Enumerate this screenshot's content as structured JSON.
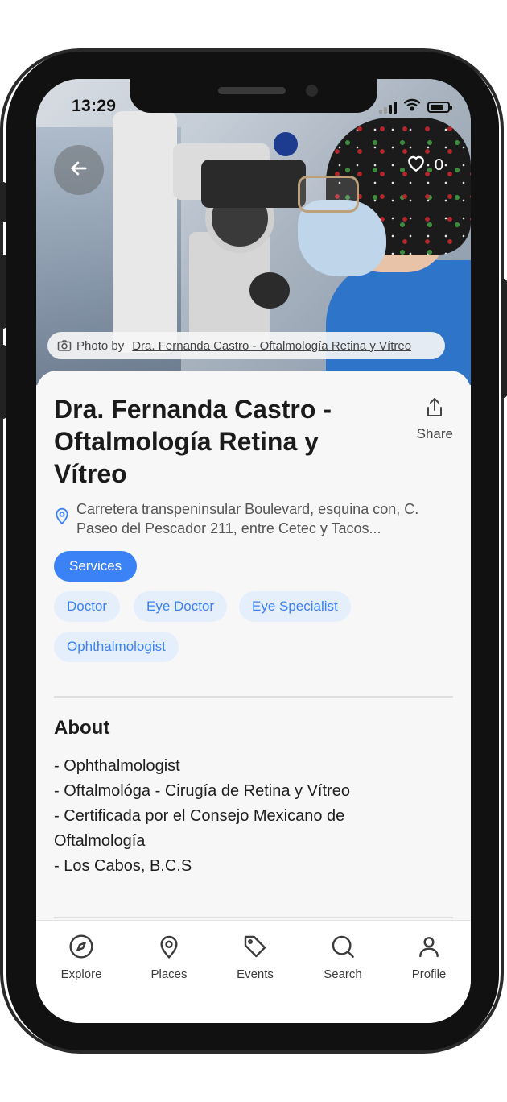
{
  "status_bar": {
    "time": "13:29"
  },
  "hero": {
    "favorites_count": "0",
    "photo_credit_prefix": "Photo by",
    "photo_credit_author": "Dra. Fernanda Castro - Oftalmología Retina y Vítreo"
  },
  "place": {
    "title": "Dra. Fernanda Castro - Oftalmología Retina y Vítreo",
    "share_label": "Share",
    "address": "Carretera transpeninsular Boulevard, esquina con, C. Paseo del Pescador 211, entre Cetec y Tacos..."
  },
  "tags": {
    "primary": "Services",
    "items": [
      "Doctor",
      "Eye Doctor",
      "Eye Specialist",
      "Ophthalmologist"
    ]
  },
  "about": {
    "heading": "About",
    "lines": [
      "- Ophthalmologist",
      "- Oftalmológa - Cirugía de Retina y Vítreo",
      "- Certificada por el Consejo Mexicano de Oftalmología",
      "- Los Cabos, B.C.S"
    ]
  },
  "tabbar": {
    "items": [
      {
        "label": "Explore",
        "icon": "compass-icon"
      },
      {
        "label": "Places",
        "icon": "map-pin-icon"
      },
      {
        "label": "Events",
        "icon": "tag-icon"
      },
      {
        "label": "Search",
        "icon": "search-icon"
      },
      {
        "label": "Profile",
        "icon": "user-icon"
      }
    ]
  },
  "colors": {
    "accent": "#3b82f6",
    "chip_bg": "#e5eefb",
    "frame": "#111111"
  }
}
